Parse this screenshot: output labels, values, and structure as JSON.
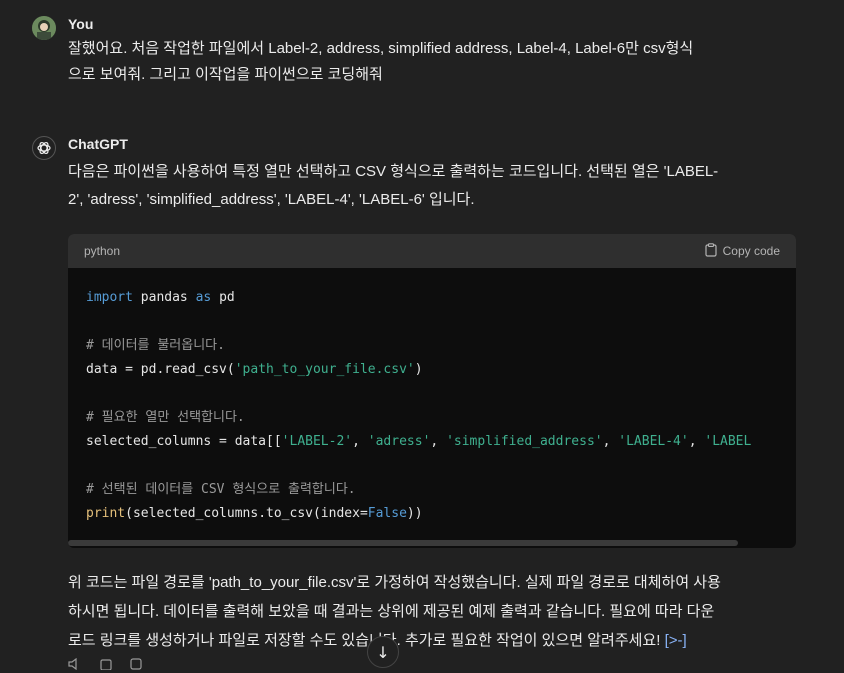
{
  "user": {
    "name": "You",
    "message_line1": "잘했어요. 처음 작업한 파일에서 Label-2, address, simplified address, Label-4, Label-6만 csv형식",
    "message_line2": "으로 보여줘. 그리고 이작업을 파이썬으로 코딩해줘"
  },
  "assistant": {
    "name": "ChatGPT",
    "intro_line1": "다음은 파이썬을 사용하여 특정 열만 선택하고 CSV 형식으로 출력하는 코드입니다. 선택된 열은 'LABEL-",
    "intro_line2": "2', 'adress', 'simplified_address', 'LABEL-4', 'LABEL-6' 입니다.",
    "code": {
      "language": "python",
      "copy_label": "Copy code",
      "lines": {
        "l1_kw1": "import",
        "l1_mid": " pandas ",
        "l1_kw2": "as",
        "l1_end": " pd",
        "c1": "# 데이터를 불러옵니다.",
        "l2_start": "data = pd.read_csv(",
        "l2_str": "'path_to_your_file.csv'",
        "l2_end": ")",
        "c2": "# 필요한 열만 선택합니다.",
        "l3_start": "selected_columns = data[[",
        "l3_s1": "'LABEL-2'",
        "l3_s2": "'adress'",
        "l3_s3": "'simplified_address'",
        "l3_s4": "'LABEL-4'",
        "l3_s5": "'LABEL",
        "sep": ", ",
        "c3": "# 선택된 데이터를 CSV 형식으로 출력합니다.",
        "l4_fn": "print",
        "l4_mid": "(selected_columns.to_csv(index=",
        "l4_kw": "False",
        "l4_end": "))"
      }
    },
    "outro_line1": "위 코드는 파일 경로를 'path_to_your_file.csv'로 가정하여 작성했습니다. 실제 파일 경로로 대체하여 사용",
    "outro_line2": "하시면 됩니다. 데이터를 출력해 보았을 때 결과는 상위에 제공된 예제 출력과 같습니다. 필요에 따라 다운",
    "outro_line3": "로드 링크를 생성하거나 파일로 저장할 수도 있습니다. 추가로 필요한 작업이 있으면 알려주세요!",
    "cite_icon": "[>-]"
  },
  "icons": {
    "scroll_down": "↓",
    "copy": "clipboard-icon",
    "gpt_logo": "openai-logo-icon"
  }
}
